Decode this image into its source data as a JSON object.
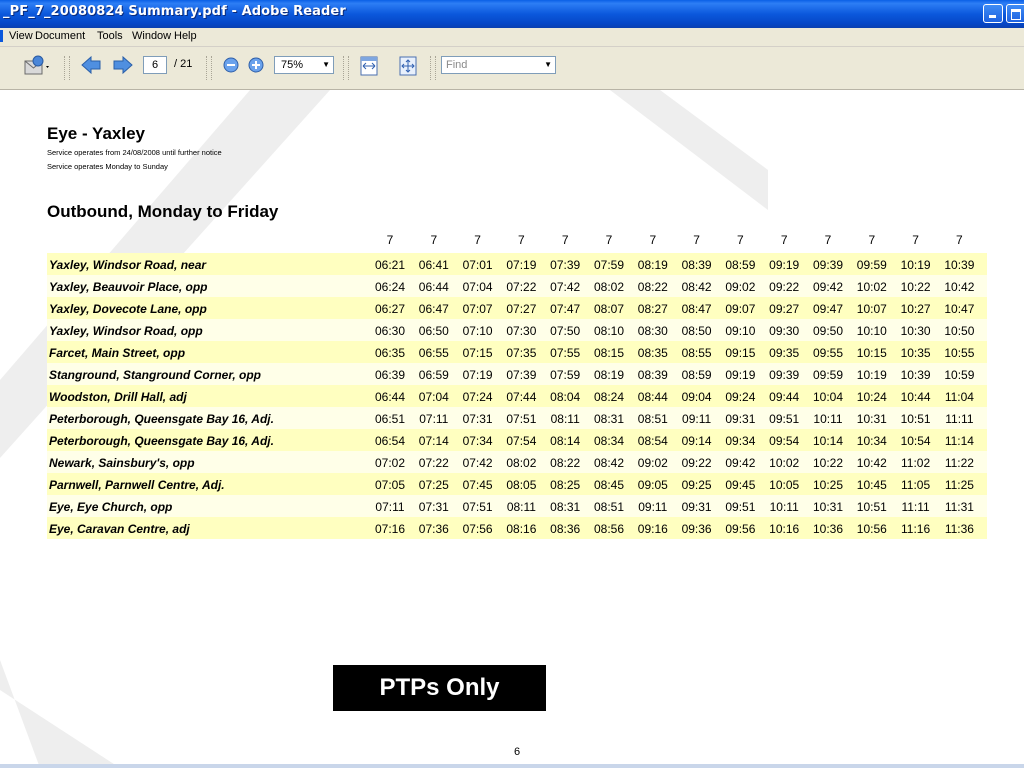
{
  "window": {
    "title": "_PF_7_20080824 Summary.pdf - Adobe Reader"
  },
  "menu": [
    "View",
    "Document",
    "Tools",
    "Window",
    "Help"
  ],
  "toolbar": {
    "current_page": "6",
    "page_total": "/ 21",
    "zoom": "75%",
    "find_placeholder": "Find"
  },
  "document": {
    "route_title": "Eye - Yaxley",
    "notes": [
      "Service operates from 24/08/2008 until further notice",
      "Service operates Monday to Sunday"
    ],
    "section_heading": "Outbound, Monday to Friday",
    "column_headers": [
      "7",
      "7",
      "7",
      "7",
      "7",
      "7",
      "7",
      "7",
      "7",
      "7",
      "7",
      "7",
      "7",
      "7"
    ],
    "stops": [
      {
        "name": "Yaxley, Windsor Road, near",
        "times": [
          "06:21",
          "06:41",
          "07:01",
          "07:19",
          "07:39",
          "07:59",
          "08:19",
          "08:39",
          "08:59",
          "09:19",
          "09:39",
          "09:59",
          "10:19",
          "10:39"
        ]
      },
      {
        "name": "Yaxley, Beauvoir Place, opp",
        "times": [
          "06:24",
          "06:44",
          "07:04",
          "07:22",
          "07:42",
          "08:02",
          "08:22",
          "08:42",
          "09:02",
          "09:22",
          "09:42",
          "10:02",
          "10:22",
          "10:42"
        ]
      },
      {
        "name": "Yaxley, Dovecote Lane, opp",
        "times": [
          "06:27",
          "06:47",
          "07:07",
          "07:27",
          "07:47",
          "08:07",
          "08:27",
          "08:47",
          "09:07",
          "09:27",
          "09:47",
          "10:07",
          "10:27",
          "10:47"
        ]
      },
      {
        "name": "Yaxley, Windsor Road, opp",
        "times": [
          "06:30",
          "06:50",
          "07:10",
          "07:30",
          "07:50",
          "08:10",
          "08:30",
          "08:50",
          "09:10",
          "09:30",
          "09:50",
          "10:10",
          "10:30",
          "10:50"
        ]
      },
      {
        "name": "Farcet, Main Street, opp",
        "times": [
          "06:35",
          "06:55",
          "07:15",
          "07:35",
          "07:55",
          "08:15",
          "08:35",
          "08:55",
          "09:15",
          "09:35",
          "09:55",
          "10:15",
          "10:35",
          "10:55"
        ]
      },
      {
        "name": "Stanground, Stanground Corner, opp",
        "times": [
          "06:39",
          "06:59",
          "07:19",
          "07:39",
          "07:59",
          "08:19",
          "08:39",
          "08:59",
          "09:19",
          "09:39",
          "09:59",
          "10:19",
          "10:39",
          "10:59"
        ]
      },
      {
        "name": "Woodston, Drill Hall, adj",
        "times": [
          "06:44",
          "07:04",
          "07:24",
          "07:44",
          "08:04",
          "08:24",
          "08:44",
          "09:04",
          "09:24",
          "09:44",
          "10:04",
          "10:24",
          "10:44",
          "11:04"
        ]
      },
      {
        "name": "Peterborough, Queensgate Bay 16, Adj.",
        "times": [
          "06:51",
          "07:11",
          "07:31",
          "07:51",
          "08:11",
          "08:31",
          "08:51",
          "09:11",
          "09:31",
          "09:51",
          "10:11",
          "10:31",
          "10:51",
          "11:11"
        ]
      },
      {
        "name": "Peterborough, Queensgate Bay 16, Adj.",
        "times": [
          "06:54",
          "07:14",
          "07:34",
          "07:54",
          "08:14",
          "08:34",
          "08:54",
          "09:14",
          "09:34",
          "09:54",
          "10:14",
          "10:34",
          "10:54",
          "11:14"
        ]
      },
      {
        "name": "Newark, Sainsbury's, opp",
        "times": [
          "07:02",
          "07:22",
          "07:42",
          "08:02",
          "08:22",
          "08:42",
          "09:02",
          "09:22",
          "09:42",
          "10:02",
          "10:22",
          "10:42",
          "11:02",
          "11:22"
        ]
      },
      {
        "name": "Parnwell, Parnwell Centre, Adj.",
        "times": [
          "07:05",
          "07:25",
          "07:45",
          "08:05",
          "08:25",
          "08:45",
          "09:05",
          "09:25",
          "09:45",
          "10:05",
          "10:25",
          "10:45",
          "11:05",
          "11:25"
        ]
      },
      {
        "name": "Eye, Eye Church, opp",
        "times": [
          "07:11",
          "07:31",
          "07:51",
          "08:11",
          "08:31",
          "08:51",
          "09:11",
          "09:31",
          "09:51",
          "10:11",
          "10:31",
          "10:51",
          "11:11",
          "11:31"
        ]
      },
      {
        "name": "Eye, Caravan Centre, adj",
        "times": [
          "07:16",
          "07:36",
          "07:56",
          "08:16",
          "08:36",
          "08:56",
          "09:16",
          "09:36",
          "09:56",
          "10:16",
          "10:36",
          "10:56",
          "11:16",
          "11:36"
        ]
      }
    ],
    "stamp": "PTPs Only",
    "page_number": "6"
  },
  "colors": {
    "titlebar": "#0b58dc",
    "row_odd": "#ffffc0",
    "row_even": "#ffffe8",
    "stamp_bg": "#000000"
  }
}
